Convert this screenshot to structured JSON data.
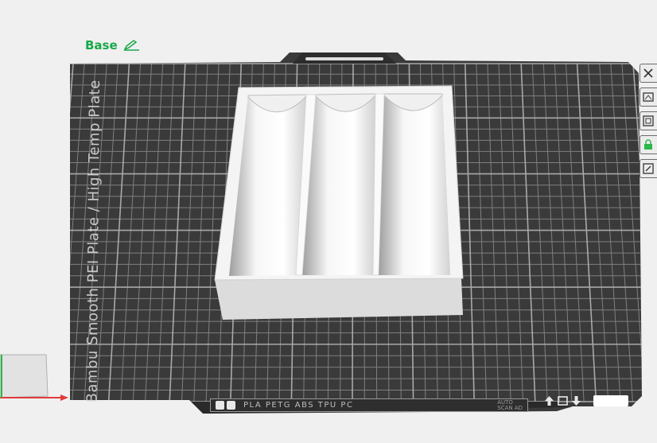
{
  "plate": {
    "label": "Base",
    "bed_marking": "Bambu Smooth PEI Plate / High Temp Plate",
    "filament_types": "PLA PETG ABS TPU PC",
    "strip_mark": "AUTO\nSCAN AD"
  },
  "icons": {
    "edit": "pencil-icon",
    "tools": [
      "close-icon",
      "arrange-icon",
      "orient-icon",
      "lock-icon",
      "settings-icon"
    ],
    "bottom": [
      "up-arrow-icon",
      "plate-icon",
      "down-arrow-icon"
    ]
  },
  "colors": {
    "bed": "#3a3a3a",
    "grid": "#8c8c8c",
    "model": "#e6e6e6",
    "label_green": "#1aa84a",
    "background": "#f0f0f0"
  }
}
